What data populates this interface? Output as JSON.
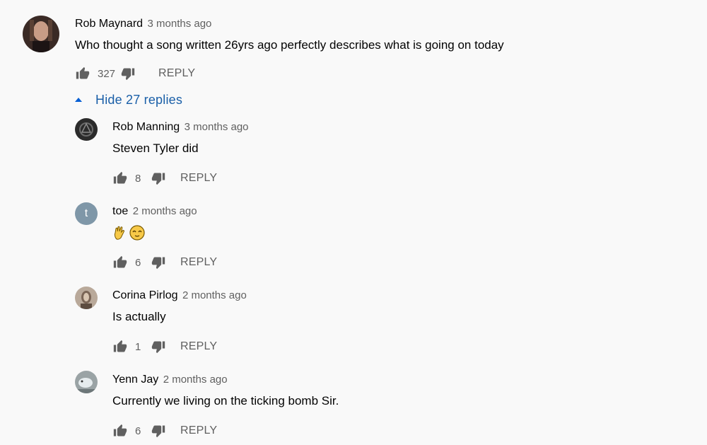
{
  "top_comment": {
    "author": "Rob Maynard",
    "time": "3 months ago",
    "text": "Who thought a song written 26yrs ago perfectly describes what is going on today",
    "likes": "327",
    "reply_label": "REPLY"
  },
  "replies_toggle": {
    "label": "Hide 27 replies",
    "icon": "caret-up-icon",
    "color": "#065fd4"
  },
  "replies": [
    {
      "author": "Rob Manning",
      "time": "3 months ago",
      "text": "Steven Tyler did",
      "likes": "8",
      "reply_label": "REPLY"
    },
    {
      "author": "toe",
      "time": "2 months ago",
      "avatar_letter": "t",
      "avatar_color": "#7f97a8",
      "emojis": [
        "vulcan-salute-emoji",
        "pleading-face-emoji"
      ],
      "likes": "6",
      "reply_label": "REPLY"
    },
    {
      "author": "Corina Pirlog",
      "time": "2 months ago",
      "text": "Is actually",
      "likes": "1",
      "reply_label": "REPLY"
    },
    {
      "author": "Yenn Jay",
      "time": "2 months ago",
      "text": "Currently we living on the ticking bomb Sir.",
      "likes": "6",
      "reply_label": "REPLY"
    }
  ],
  "icons": {
    "like": "thumb-up-icon",
    "dislike": "thumb-down-icon"
  }
}
